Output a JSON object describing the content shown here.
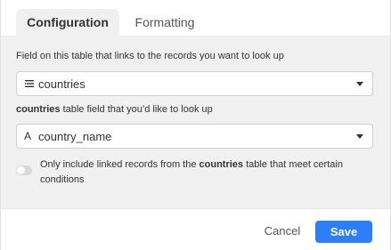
{
  "tabs": [
    {
      "label": "Configuration",
      "active": true
    },
    {
      "label": "Formatting",
      "active": false
    }
  ],
  "link_field": {
    "label": "Field on this table that links to the records you want to look up",
    "value": "countries",
    "icon": "list-lines-icon"
  },
  "lookup_field": {
    "label_table": "countries",
    "label_rest": " table field that you’d like to look up",
    "value": "country_name",
    "icon_glyph": "A",
    "icon": "text-field-icon"
  },
  "condition_toggle": {
    "checked": false,
    "text_before": "Only include linked records from the ",
    "text_table": "countries",
    "text_after": " table that meet certain conditions"
  },
  "footer": {
    "cancel_label": "Cancel",
    "save_label": "Save"
  },
  "colors": {
    "accent": "#2d7ff9",
    "panel_bg": "#f0f0f0"
  }
}
